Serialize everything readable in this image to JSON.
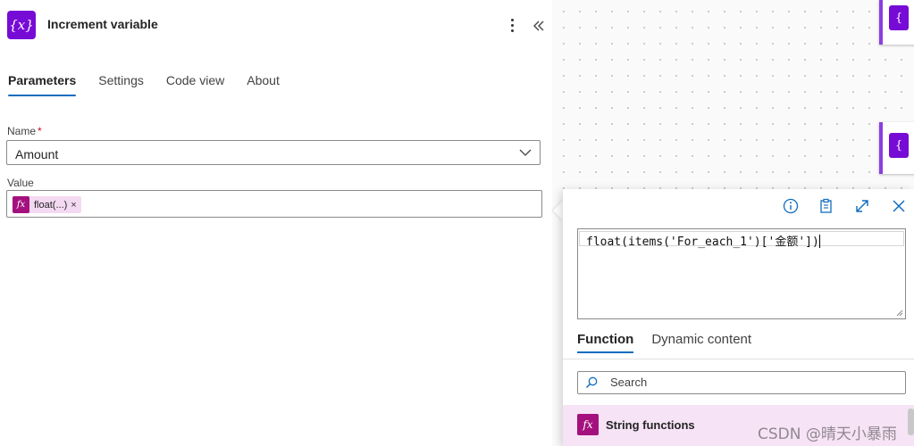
{
  "header": {
    "icon_text": "{x}",
    "title": "Increment variable"
  },
  "tabs": [
    {
      "label": "Parameters",
      "active": true
    },
    {
      "label": "Settings"
    },
    {
      "label": "Code view"
    },
    {
      "label": "About"
    }
  ],
  "fields": {
    "name_label": "Name",
    "name_required_mark": "*",
    "name_value": "Amount",
    "value_label": "Value",
    "value_token": "float(...)",
    "value_token_remove": "×"
  },
  "canvas_nodes": [
    {
      "icon_text": "{"
    },
    {
      "icon_text": "{"
    }
  ],
  "expression_editor": {
    "expression": "float(items('For_each_1')['金额'])",
    "tabs": [
      {
        "label": "Function",
        "active": true
      },
      {
        "label": "Dynamic content"
      }
    ],
    "search_placeholder": "Search",
    "category_icon": "fx",
    "category_label": "String functions"
  },
  "watermark": "CSDN @晴天小暴雨",
  "colors": {
    "accent": "#0f6cbd",
    "variable_icon": "#770bd6",
    "function_icon": "#a4117e",
    "function_bg": "#f6e3f5"
  }
}
